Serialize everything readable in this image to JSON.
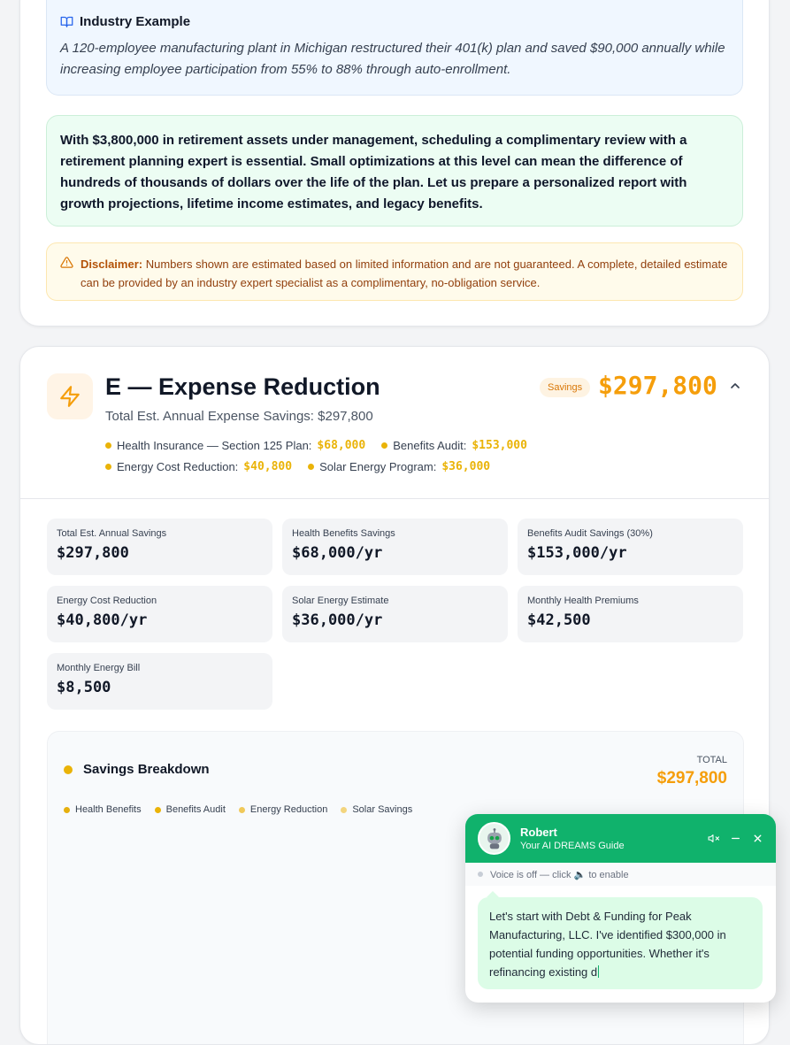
{
  "industry": {
    "title": "Industry Example",
    "body": "A 120-employee manufacturing plant in Michigan restructured their 401(k) plan and saved $90,000 annually while increasing employee participation from 55% to 88% through auto-enrollment."
  },
  "recommendation": "With $3,800,000 in retirement assets under management, scheduling a complimentary review with a retirement planning expert is essential. Small optimizations at this level can mean the difference of hundreds of thousands of dollars over the life of the plan. Let us prepare a personalized report with growth projections, lifetime income estimates, and legacy benefits.",
  "disclaimer": {
    "label": "Disclaimer:",
    "text": "Numbers shown are estimated based on limited information and are not guaranteed. A complete, detailed estimate can be provided by an industry expert specialist as a complimentary, no-obligation service."
  },
  "section": {
    "title": "E — Expense Reduction",
    "subtitle": "Total Est. Annual Expense Savings: $297,800",
    "badge": "Savings",
    "total": "$297,800",
    "bullets": [
      {
        "label": "Health Insurance — Section 125 Plan:",
        "value": "$68,000"
      },
      {
        "label": "Benefits Audit:",
        "value": "$153,000"
      },
      {
        "label": "Energy Cost Reduction:",
        "value": "$40,800"
      },
      {
        "label": "Solar Energy Program:",
        "value": "$36,000"
      }
    ]
  },
  "stats": [
    {
      "label": "Total Est. Annual Savings",
      "value": "$297,800"
    },
    {
      "label": "Health Benefits Savings",
      "value": "$68,000/yr"
    },
    {
      "label": "Benefits Audit Savings (30%)",
      "value": "$153,000/yr"
    },
    {
      "label": "Energy Cost Reduction",
      "value": "$40,800/yr"
    },
    {
      "label": "Solar Energy Estimate",
      "value": "$36,000/yr"
    },
    {
      "label": "Monthly Health Premiums",
      "value": "$42,500"
    },
    {
      "label": "Monthly Energy Bill",
      "value": "$8,500"
    }
  ],
  "breakdown": {
    "title": "Savings Breakdown",
    "total_label": "TOTAL",
    "total": "$297,800",
    "legend": [
      "Health Benefits",
      "Benefits Audit",
      "Energy Reduction",
      "Solar Savings"
    ]
  },
  "chat": {
    "name": "Robert",
    "role": "Your AI DREAMS Guide",
    "voice_status_pre": "Voice is off — click",
    "voice_status_post": "to enable",
    "message": "Let's start with Debt & Funding for Peak Manufacturing, LLC. I've identified $300,000 in potential funding opportunities. Whether it's refinancing existing d"
  },
  "colors": {
    "accent_orange": "#f59e0b",
    "bullet_yellow": "#eab308",
    "chat_green": "#10b26c",
    "green_box": "#ecfdf3",
    "disclaimer_bg": "#fffbeb",
    "industry_bg": "#f0f7ff"
  }
}
